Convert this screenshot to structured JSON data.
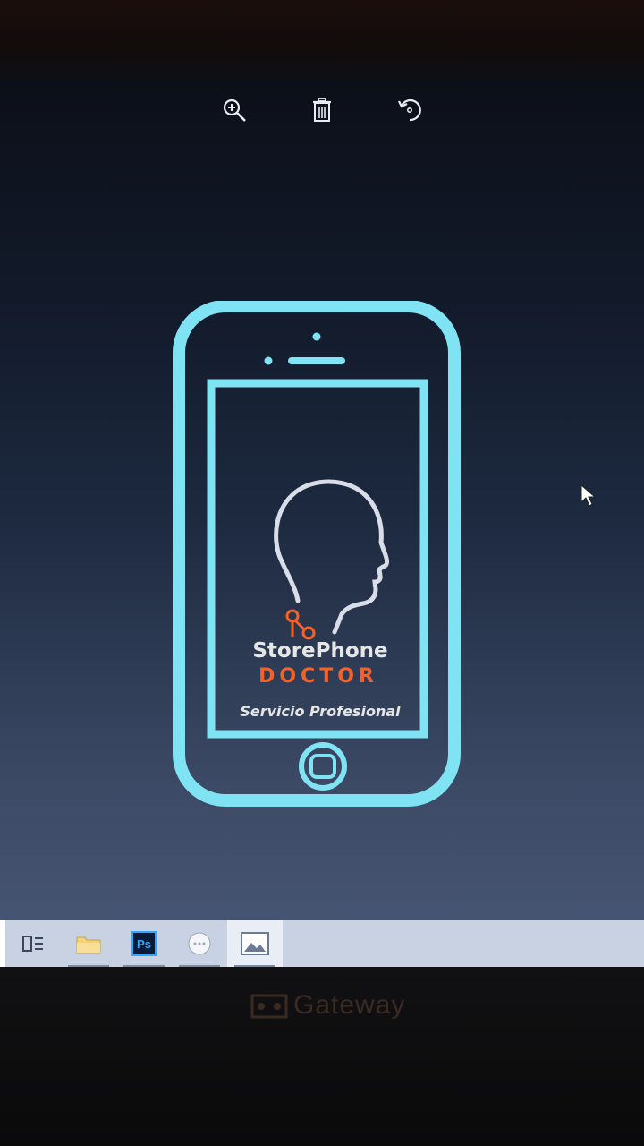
{
  "toolbar": {
    "icons": [
      "zoom-in-icon",
      "trash-icon",
      "rotate-icon"
    ]
  },
  "artwork": {
    "brand_line1": "StorePhone",
    "brand_line2": "DOCTOR",
    "tagline": "Servicio Profesional",
    "colors": {
      "outline": "#7fe3f3",
      "accent": "#f2622a",
      "text": "#e6e6e6"
    }
  },
  "taskbar": {
    "items": [
      {
        "icon": "task-view-icon"
      },
      {
        "icon": "file-explorer-icon"
      },
      {
        "icon": "photoshop-icon",
        "label": "Ps"
      },
      {
        "icon": "chat-icon"
      },
      {
        "icon": "photos-icon"
      }
    ]
  },
  "bezel": {
    "brand": "Gateway"
  }
}
